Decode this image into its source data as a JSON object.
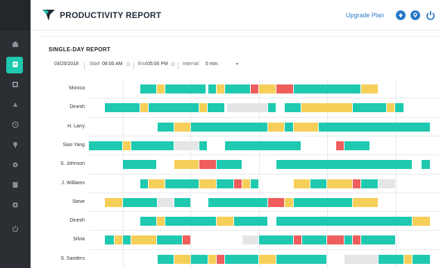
{
  "header": {
    "title": "PRODUCTIVITY REPORT",
    "upgrade_label": "Upgrade Plan",
    "logo_icon": "logo-bird-icon"
  },
  "sidebar": {
    "items": [
      {
        "icon": "dashboard-icon"
      },
      {
        "icon": "report-icon",
        "active": true
      },
      {
        "icon": "users-icon"
      },
      {
        "icon": "chart-icon"
      },
      {
        "icon": "clock-icon"
      },
      {
        "icon": "bulb-icon"
      },
      {
        "icon": "settings-icon"
      },
      {
        "icon": "file-icon"
      },
      {
        "icon": "gear-icon"
      },
      {
        "icon": "power-icon"
      }
    ]
  },
  "report": {
    "title": "SINGLE-DAY REPORT",
    "date": "03/20/2018",
    "start_label": "Start",
    "start_value": "08:00 AM",
    "end_label": "End",
    "end_value": "05:00 PM",
    "interval_label": "Interval",
    "interval_value": "5 min."
  },
  "colors": {
    "teal": "#1ec9b0",
    "yellow": "#f6cf58",
    "red": "#ef5d5d",
    "gray": "#e3e5e7",
    "accent": "#2a78c6"
  },
  "rows": [
    {
      "name": "Monica",
      "segs": [
        [
          202,
          226,
          "teal"
        ],
        [
          226,
          238,
          "yellow"
        ],
        [
          238,
          297,
          "teal"
        ],
        [
          300,
          312,
          "teal"
        ],
        [
          312,
          324,
          "yellow"
        ],
        [
          324,
          361,
          "teal"
        ],
        [
          361,
          373,
          "red"
        ],
        [
          373,
          398,
          "yellow"
        ],
        [
          398,
          423,
          "red"
        ],
        [
          423,
          520,
          "teal"
        ],
        [
          520,
          545,
          "yellow"
        ]
      ]
    },
    {
      "name": "Dinesh",
      "segs": [
        [
          151,
          202,
          "teal"
        ],
        [
          202,
          214,
          "yellow"
        ],
        [
          214,
          287,
          "teal"
        ],
        [
          287,
          299,
          "yellow"
        ],
        [
          299,
          324,
          "teal"
        ],
        [
          327,
          386,
          "gray"
        ],
        [
          386,
          398,
          "teal"
        ],
        [
          410,
          434,
          "teal"
        ],
        [
          434,
          508,
          "yellow"
        ],
        [
          508,
          557,
          "teal"
        ],
        [
          557,
          569,
          "yellow"
        ],
        [
          569,
          582,
          "teal"
        ]
      ]
    },
    {
      "name": "H. Larry",
      "segs": [
        [
          227,
          251,
          "teal"
        ],
        [
          251,
          275,
          "yellow"
        ],
        [
          275,
          386,
          "teal"
        ],
        [
          386,
          410,
          "yellow"
        ],
        [
          410,
          423,
          "teal"
        ],
        [
          423,
          459,
          "yellow"
        ],
        [
          459,
          620,
          "teal"
        ]
      ]
    },
    {
      "name": "Sian Yang",
      "segs": [
        [
          128,
          177,
          "teal"
        ],
        [
          177,
          189,
          "yellow"
        ],
        [
          189,
          251,
          "teal"
        ],
        [
          251,
          287,
          "gray"
        ],
        [
          287,
          299,
          "teal"
        ],
        [
          324,
          434,
          "teal"
        ],
        [
          484,
          496,
          "red"
        ],
        [
          496,
          533,
          "teal"
        ]
      ]
    },
    {
      "name": "S. Johnson",
      "segs": [
        [
          177,
          226,
          "teal"
        ],
        [
          251,
          287,
          "yellow"
        ],
        [
          287,
          312,
          "red"
        ],
        [
          312,
          349,
          "teal"
        ],
        [
          398,
          594,
          "teal"
        ],
        [
          607,
          620,
          "teal"
        ]
      ]
    },
    {
      "name": "J. Williams",
      "segs": [
        [
          202,
          214,
          "teal"
        ],
        [
          214,
          238,
          "yellow"
        ],
        [
          238,
          287,
          "teal"
        ],
        [
          287,
          312,
          "yellow"
        ],
        [
          312,
          337,
          "teal"
        ],
        [
          337,
          349,
          "red"
        ],
        [
          349,
          361,
          "yellow"
        ],
        [
          361,
          373,
          "teal"
        ],
        [
          423,
          447,
          "yellow"
        ],
        [
          447,
          471,
          "teal"
        ],
        [
          471,
          508,
          "yellow"
        ],
        [
          508,
          520,
          "red"
        ],
        [
          520,
          545,
          "teal"
        ],
        [
          545,
          570,
          "gray"
        ]
      ]
    },
    {
      "name": "Steve",
      "segs": [
        [
          151,
          177,
          "yellow"
        ],
        [
          177,
          227,
          "teal"
        ],
        [
          227,
          251,
          "gray"
        ],
        [
          251,
          275,
          "teal"
        ],
        [
          300,
          386,
          "teal"
        ],
        [
          386,
          410,
          "red"
        ],
        [
          410,
          423,
          "yellow"
        ],
        [
          423,
          508,
          "teal"
        ],
        [
          508,
          545,
          "yellow"
        ]
      ]
    },
    {
      "name": "Dinesh",
      "segs": [
        [
          202,
          226,
          "teal"
        ],
        [
          226,
          238,
          "yellow"
        ],
        [
          238,
          312,
          "teal"
        ],
        [
          312,
          337,
          "yellow"
        ],
        [
          337,
          386,
          "teal"
        ],
        [
          398,
          594,
          "teal"
        ],
        [
          594,
          620,
          "yellow"
        ]
      ]
    },
    {
      "name": "Silvia",
      "segs": [
        [
          151,
          165,
          "teal"
        ],
        [
          165,
          177,
          "yellow"
        ],
        [
          177,
          189,
          "teal"
        ],
        [
          189,
          226,
          "yellow"
        ],
        [
          226,
          263,
          "teal"
        ],
        [
          263,
          275,
          "red"
        ],
        [
          349,
          373,
          "gray"
        ],
        [
          373,
          423,
          "teal"
        ],
        [
          423,
          435,
          "red"
        ],
        [
          435,
          471,
          "teal"
        ],
        [
          471,
          496,
          "red"
        ],
        [
          496,
          508,
          "teal"
        ],
        [
          508,
          520,
          "red"
        ],
        [
          520,
          570,
          "teal"
        ]
      ]
    },
    {
      "name": "S. Sanders",
      "segs": [
        [
          227,
          251,
          "teal"
        ],
        [
          251,
          275,
          "yellow"
        ],
        [
          275,
          300,
          "teal"
        ],
        [
          300,
          312,
          "yellow"
        ],
        [
          312,
          324,
          "red"
        ],
        [
          324,
          373,
          "teal"
        ],
        [
          373,
          398,
          "yellow"
        ],
        [
          398,
          471,
          "teal"
        ],
        [
          496,
          545,
          "gray"
        ],
        [
          545,
          582,
          "teal"
        ],
        [
          582,
          594,
          "yellow"
        ],
        [
          594,
          620,
          "teal"
        ]
      ]
    }
  ]
}
